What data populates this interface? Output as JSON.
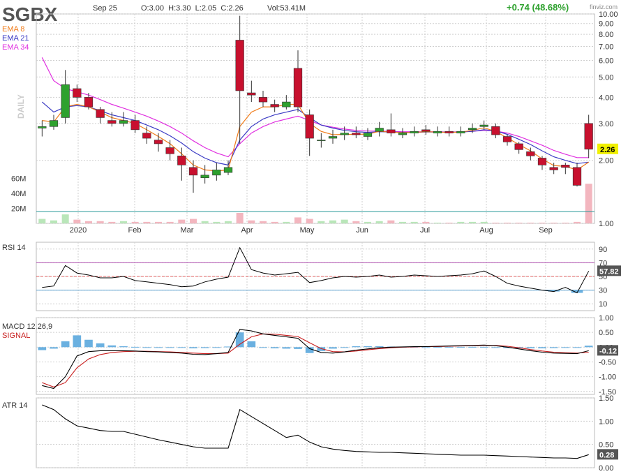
{
  "header": {
    "ticker": "SGBX",
    "date": "Sep 25",
    "ohlc": "O:3.00  H:3.30  L:2.05  C:2.26",
    "volume": "Vol:53.41M",
    "change": "+0.74 (48.68%)",
    "brand": "finviz.com"
  },
  "legend": {
    "ema8": "EMA 8",
    "ema21": "EMA 21",
    "ema34": "EMA 34",
    "daily": "DAILY"
  },
  "colors": {
    "up": "#2ea12e",
    "down": "#c8102e",
    "ema8": "#f07c1a",
    "ema21": "#3a3ac4",
    "ema34": "#e030e0",
    "grid": "#cfcfcf",
    "rsi": "#000000",
    "macd": "#000000",
    "signal": "#c81e1e",
    "hist": "#6ab0e0",
    "atr": "#000000",
    "price_label_bg": "#f0f000",
    "label_bg": "#555555",
    "change_text": "#2ea12e"
  },
  "chart_data": [
    {
      "type": "candlestick",
      "name": "price",
      "ylim": [
        1.0,
        10.0
      ],
      "y_scale": "log",
      "yticks": [
        "10.00",
        "9.00",
        "8.00",
        "7.00",
        "6.00",
        "5.00",
        "4.00",
        "3.00",
        "2.00",
        "1.00"
      ],
      "volume_ticks": [
        "60M",
        "40M",
        "20M"
      ],
      "months": [
        "2020",
        "Feb",
        "Mar",
        "Apr",
        "May",
        "Jun",
        "Jul",
        "Aug",
        "Sep"
      ],
      "last_price_label": "2.26",
      "x": [
        "Jan 02",
        "Jan 08",
        "Jan 13",
        "Jan 16",
        "Jan 22",
        "Jan 28",
        "Feb 03",
        "Feb 07",
        "Feb 13",
        "Feb 20",
        "Feb 26",
        "Mar 03",
        "Mar 09",
        "Mar 13",
        "Mar 19",
        "Mar 25",
        "Mar 31",
        "Apr 03",
        "Apr 09",
        "Apr 15",
        "Apr 21",
        "Apr 27",
        "May 01",
        "May 07",
        "May 13",
        "May 19",
        "May 27",
        "Jun 02",
        "Jun 08",
        "Jun 12",
        "Jun 18",
        "Jun 24",
        "Jun 30",
        "Jul 07",
        "Jul 13",
        "Jul 17",
        "Jul 23",
        "Jul 29",
        "Aug 04",
        "Aug 10",
        "Aug 14",
        "Aug 20",
        "Aug 26",
        "Sep 01",
        "Sep 08",
        "Sep 14",
        "Sep 18",
        "Sep 25"
      ],
      "open": [
        2.85,
        2.9,
        3.2,
        4.4,
        4.0,
        3.5,
        3.1,
        3.0,
        3.1,
        2.7,
        2.5,
        2.3,
        2.1,
        1.85,
        1.65,
        1.7,
        1.75,
        7.5,
        4.2,
        4.0,
        3.7,
        3.6,
        5.5,
        3.3,
        2.5,
        2.55,
        2.65,
        2.7,
        2.6,
        2.75,
        2.8,
        2.65,
        2.7,
        2.8,
        2.7,
        2.75,
        2.7,
        2.8,
        2.9,
        2.9,
        2.6,
        2.4,
        2.2,
        2.05,
        1.85,
        1.9,
        1.85,
        3.0
      ],
      "close": [
        2.9,
        3.1,
        4.6,
        4.0,
        3.6,
        3.2,
        3.0,
        3.1,
        2.8,
        2.55,
        2.4,
        2.15,
        1.9,
        1.7,
        1.7,
        1.8,
        1.85,
        4.3,
        4.1,
        3.8,
        3.6,
        3.8,
        3.6,
        2.55,
        2.5,
        2.6,
        2.7,
        2.65,
        2.7,
        2.85,
        2.7,
        2.7,
        2.75,
        2.75,
        2.75,
        2.7,
        2.75,
        2.85,
        2.95,
        2.65,
        2.45,
        2.25,
        2.1,
        1.9,
        1.8,
        1.85,
        1.52,
        2.26
      ],
      "high": [
        3.1,
        3.3,
        5.4,
        4.6,
        4.2,
        3.6,
        3.4,
        3.4,
        3.3,
        2.9,
        2.7,
        2.5,
        2.3,
        2.0,
        1.9,
        1.95,
        2.0,
        9.8,
        4.8,
        4.3,
        3.9,
        4.1,
        6.7,
        3.5,
        2.7,
        2.8,
        2.9,
        2.9,
        2.85,
        3.05,
        3.35,
        2.85,
        2.9,
        2.95,
        2.9,
        2.9,
        2.9,
        3.0,
        3.1,
        3.0,
        2.65,
        2.45,
        2.3,
        2.1,
        1.95,
        1.95,
        1.95,
        3.3
      ],
      "low": [
        2.6,
        2.8,
        3.0,
        3.8,
        3.5,
        3.0,
        2.9,
        2.9,
        2.7,
        2.4,
        2.2,
        2.0,
        1.6,
        1.4,
        1.55,
        1.6,
        1.7,
        2.4,
        3.8,
        3.6,
        3.4,
        3.5,
        3.4,
        2.1,
        2.3,
        2.4,
        2.5,
        2.55,
        2.5,
        2.6,
        2.6,
        2.55,
        2.6,
        2.65,
        2.6,
        2.6,
        2.6,
        2.7,
        2.8,
        2.55,
        2.35,
        2.15,
        2.0,
        1.8,
        1.72,
        1.72,
        1.5,
        2.05
      ],
      "ema8": [
        3.1,
        3.05,
        3.6,
        3.7,
        3.6,
        3.4,
        3.2,
        3.1,
        3.0,
        2.8,
        2.6,
        2.4,
        2.15,
        1.9,
        1.8,
        1.78,
        1.8,
        2.9,
        3.4,
        3.6,
        3.6,
        3.7,
        3.7,
        3.0,
        2.75,
        2.65,
        2.66,
        2.66,
        2.67,
        2.75,
        2.73,
        2.71,
        2.72,
        2.74,
        2.73,
        2.72,
        2.73,
        2.78,
        2.86,
        2.75,
        2.56,
        2.38,
        2.22,
        2.03,
        1.89,
        1.87,
        1.8,
        1.96
      ],
      "ema21": [
        3.8,
        3.4,
        3.6,
        3.65,
        3.6,
        3.45,
        3.3,
        3.2,
        3.1,
        2.95,
        2.8,
        2.62,
        2.42,
        2.2,
        2.05,
        1.95,
        1.9,
        2.5,
        2.9,
        3.15,
        3.3,
        3.4,
        3.5,
        3.2,
        2.95,
        2.85,
        2.78,
        2.74,
        2.72,
        2.74,
        2.73,
        2.72,
        2.72,
        2.73,
        2.73,
        2.72,
        2.73,
        2.75,
        2.8,
        2.77,
        2.66,
        2.52,
        2.38,
        2.22,
        2.08,
        2.0,
        1.93,
        1.96
      ],
      "ema34": [
        6.2,
        4.8,
        4.4,
        4.25,
        4.1,
        3.9,
        3.7,
        3.55,
        3.4,
        3.25,
        3.08,
        2.9,
        2.7,
        2.48,
        2.3,
        2.17,
        2.08,
        2.4,
        2.7,
        2.9,
        3.05,
        3.15,
        3.25,
        3.1,
        2.95,
        2.88,
        2.82,
        2.78,
        2.76,
        2.76,
        2.75,
        2.74,
        2.74,
        2.74,
        2.74,
        2.73,
        2.74,
        2.75,
        2.78,
        2.76,
        2.7,
        2.6,
        2.48,
        2.36,
        2.23,
        2.14,
        2.06,
        2.06
      ],
      "volume_m": [
        6,
        4,
        12,
        5,
        3,
        3,
        2,
        3,
        2,
        2,
        2,
        2,
        5,
        6,
        3,
        2,
        3,
        14,
        4,
        3,
        2,
        2,
        8,
        6,
        3,
        4,
        5,
        3,
        2,
        3,
        4,
        2,
        2,
        2,
        1,
        1,
        2,
        2,
        2,
        1,
        1,
        1,
        1,
        1,
        1,
        1,
        2,
        53
      ]
    },
    {
      "type": "line",
      "name": "RSI 14",
      "ylim": [
        0,
        100
      ],
      "yticks": [
        "90",
        "70",
        "50",
        "30",
        "10"
      ],
      "levels": [
        70,
        50,
        30
      ],
      "last_label": "57.82",
      "values": [
        34,
        36,
        66,
        55,
        52,
        48,
        48,
        50,
        44,
        42,
        40,
        38,
        35,
        36,
        42,
        46,
        49,
        92,
        60,
        55,
        52,
        54,
        56,
        41,
        44,
        48,
        50,
        49,
        50,
        52,
        49,
        50,
        52,
        51,
        50,
        51,
        52,
        54,
        58,
        50,
        40,
        36,
        33,
        30,
        28,
        34,
        26,
        57.82
      ]
    },
    {
      "type": "line",
      "name": "MACD 12,26,9",
      "signal_label": "SIGNAL",
      "ylim": [
        -1.6,
        1.0
      ],
      "yticks": [
        "1.00",
        "0.50",
        "0.00",
        "-0.50",
        "-1.00",
        "-1.50"
      ],
      "last_label": "-0.12",
      "macd": [
        -1.3,
        -1.4,
        -1.0,
        -0.3,
        -0.15,
        -0.12,
        -0.12,
        -0.12,
        -0.13,
        -0.15,
        -0.16,
        -0.18,
        -0.2,
        -0.24,
        -0.25,
        -0.22,
        -0.18,
        0.6,
        0.55,
        0.45,
        0.4,
        0.35,
        0.3,
        -0.05,
        -0.18,
        -0.2,
        -0.16,
        -0.1,
        -0.06,
        -0.02,
        0.0,
        0.01,
        0.02,
        0.02,
        0.03,
        0.04,
        0.05,
        0.06,
        0.07,
        0.05,
        0.0,
        -0.06,
        -0.12,
        -0.17,
        -0.2,
        -0.21,
        -0.22,
        -0.12
      ],
      "signal": [
        -1.2,
        -1.35,
        -1.2,
        -0.7,
        -0.4,
        -0.25,
        -0.18,
        -0.15,
        -0.14,
        -0.14,
        -0.15,
        -0.16,
        -0.18,
        -0.2,
        -0.22,
        -0.22,
        -0.2,
        0.1,
        0.35,
        0.45,
        0.44,
        0.4,
        0.36,
        0.15,
        -0.05,
        -0.15,
        -0.16,
        -0.13,
        -0.09,
        -0.05,
        -0.02,
        0.0,
        0.01,
        0.02,
        0.02,
        0.03,
        0.04,
        0.05,
        0.06,
        0.06,
        0.03,
        -0.02,
        -0.08,
        -0.13,
        -0.17,
        -0.19,
        -0.2,
        -0.17
      ]
    },
    {
      "type": "line",
      "name": "ATR 14",
      "ylim": [
        0.0,
        1.5
      ],
      "yticks": [
        "1.50",
        "1.00",
        "0.50",
        "0.00"
      ],
      "last_label": "0.28",
      "values": [
        1.35,
        1.25,
        1.05,
        0.9,
        0.85,
        0.8,
        0.78,
        0.78,
        0.72,
        0.66,
        0.6,
        0.55,
        0.5,
        0.45,
        0.42,
        0.42,
        0.42,
        1.25,
        1.1,
        0.95,
        0.8,
        0.65,
        0.7,
        0.55,
        0.45,
        0.4,
        0.37,
        0.35,
        0.34,
        0.33,
        0.33,
        0.32,
        0.31,
        0.3,
        0.29,
        0.28,
        0.27,
        0.27,
        0.27,
        0.26,
        0.25,
        0.24,
        0.23,
        0.22,
        0.21,
        0.21,
        0.2,
        0.28
      ]
    }
  ]
}
